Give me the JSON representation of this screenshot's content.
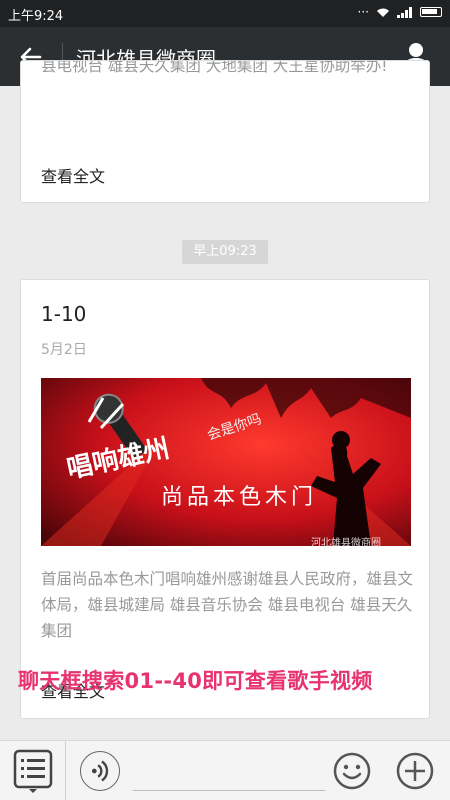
{
  "status_bar": {
    "time": "上午9:24"
  },
  "header": {
    "title": "河北雄县微商圈"
  },
  "posts": [
    {
      "excerpt": "县电视台 雄县天久集团 大地集团 大王星协助举办!",
      "read_more": "查看全文"
    },
    {
      "timestamp": "早上09:23",
      "title": "1-10",
      "date": "5月2日",
      "banner": {
        "headline": "唱响雄州",
        "subtitle": "尚品本色木门",
        "tagline": "会是你吗",
        "watermark": "河北雄县微商圈"
      },
      "excerpt": "首届尚品本色木门唱响雄州感谢雄县人民政府，雄县文体局，雄县城建局 雄县音乐协会  雄县电视台 雄县天久集团",
      "read_more": "查看全文"
    }
  ],
  "overlay_text": "聊天框搜索01--40即可查看歌手视频",
  "colors": {
    "header": "#2b2f31",
    "overlay": "#e8336e",
    "banner": "#c8101a"
  },
  "icons": [
    "back-arrow-icon",
    "profile-icon",
    "menu-list-icon",
    "voice-icon",
    "emoji-icon",
    "plus-icon"
  ]
}
